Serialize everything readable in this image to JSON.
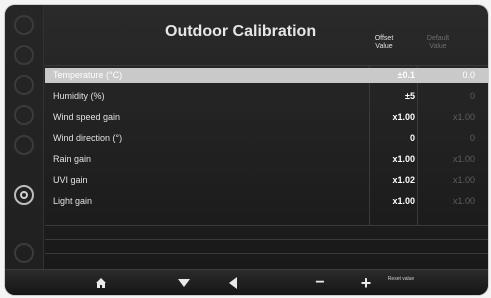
{
  "header": {
    "title": "Outdoor Calibration",
    "col_offset": "Offset Value",
    "col_default": "Default Value"
  },
  "rows": [
    {
      "label": "Temperature (°C)",
      "offset": "±0.1",
      "default": "0.0",
      "selected": true
    },
    {
      "label": "Humidity (%)",
      "offset": "±5",
      "default": "0",
      "selected": false
    },
    {
      "label": "Wind speed gain",
      "offset": "x1.00",
      "default": "x1.00",
      "selected": false
    },
    {
      "label": "Wind direction (°)",
      "offset": "0",
      "default": "0",
      "selected": false
    },
    {
      "label": "Rain gain",
      "offset": "x1.00",
      "default": "x1.00",
      "selected": false
    },
    {
      "label": "UVI gain",
      "offset": "x1.02",
      "default": "x1.00",
      "selected": false
    },
    {
      "label": "Light gain",
      "offset": "x1.00",
      "default": "x1.00",
      "selected": false
    }
  ],
  "toolbar": {
    "home": "home-icon",
    "down": "down-arrow-icon",
    "left": "left-arrow-icon",
    "minus": "−",
    "plus": "+",
    "reset_label": "Reset value"
  },
  "rail": [
    "clock-icon",
    "search-icon",
    "chart-icon",
    "settings-icon",
    "calendar-icon",
    "gear-icon",
    "camera-icon"
  ]
}
